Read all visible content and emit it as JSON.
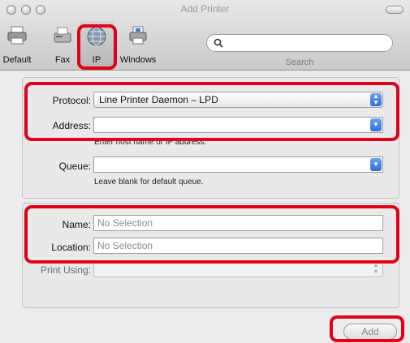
{
  "window": {
    "title": "Add Printer"
  },
  "toolbar": {
    "items": [
      {
        "label": "Default",
        "icon": "default-printer-icon"
      },
      {
        "label": "Fax",
        "icon": "fax-icon"
      },
      {
        "label": "IP",
        "icon": "ip-globe-icon",
        "selected": true
      },
      {
        "label": "Windows",
        "icon": "windows-printer-icon"
      }
    ],
    "search_label": "Search",
    "search_value": ""
  },
  "form": {
    "protocol_label": "Protocol:",
    "protocol_value": "Line Printer Daemon – LPD",
    "address_label": "Address:",
    "address_value": "",
    "address_hint": "Enter host name or IP address.",
    "queue_label": "Queue:",
    "queue_value": "",
    "queue_hint": "Leave blank for default queue."
  },
  "details": {
    "name_label": "Name:",
    "name_value": "No Selection",
    "location_label": "Location:",
    "location_value": "No Selection",
    "print_using_label": "Print Using:",
    "print_using_value": ""
  },
  "footer": {
    "add_label": "Add"
  },
  "colors": {
    "highlight": "#e0001a",
    "accent": "#2f6ed8"
  }
}
